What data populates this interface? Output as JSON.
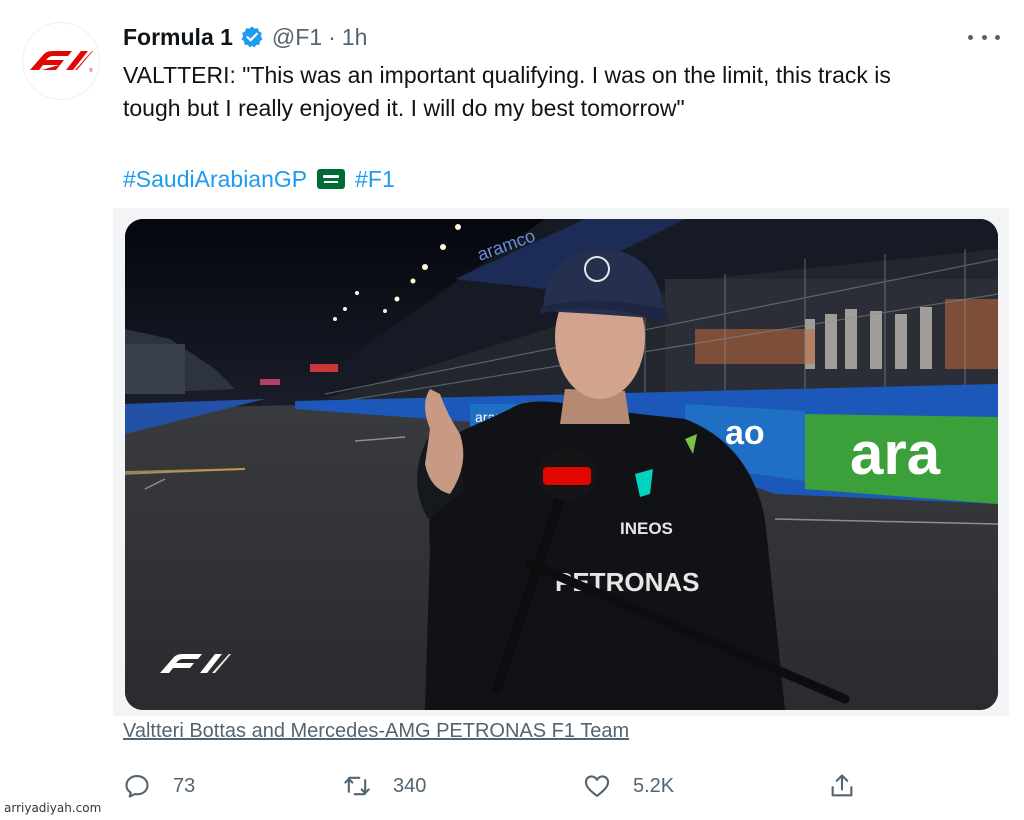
{
  "tweet": {
    "author_name": "Formula 1",
    "handle": "@F1",
    "separator": "·",
    "time": "1h",
    "text": "VALTTERI: \"This was an important qualifying. I was on the limit, this track is\ntough but I really enjoyed it. I will do my best tomorrow\"",
    "hashtag_1": "#SaudiArabianGP",
    "hashtag_2": "#F1",
    "flag_emoji": "saudi-arabia-flag",
    "media_caption": "Valtteri Bottas and Mercedes-AMG PETRONAS F1 Team",
    "media_sign_1": "aramco",
    "media_sign_2": "ara",
    "media_sign_3": "aramco",
    "media_suit_text": "PETRONAS",
    "media_suit_text_short": "INEOS"
  },
  "actions": {
    "reply_count": "73",
    "retweet_count": "340",
    "like_count": "5.2K"
  },
  "watermark": "arriyadiyah.com",
  "colors": {
    "f1_red": "#e10600",
    "link_blue": "#1d9bf0",
    "verified_blue": "#1d9bf0",
    "secondary_text": "#536471",
    "aramco_green": "#3ba03a",
    "aramco_blue": "#1f6fc5"
  }
}
